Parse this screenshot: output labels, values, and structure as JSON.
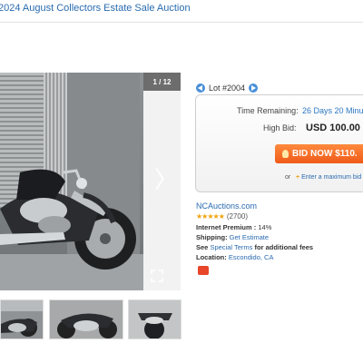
{
  "header": {
    "breadcrumb": "2024 August Collectors Estate Sale Auction"
  },
  "gallery": {
    "counter": "1 / 12",
    "thumbnails": [
      "thumb-1",
      "thumb-2",
      "thumb-3"
    ]
  },
  "lot": {
    "label": "Lot #2004"
  },
  "bid": {
    "time_label": "Time Remaining:",
    "time_value": "26 Days 20 Minu",
    "high_label": "High Bid:",
    "high_value": "USD 100.00",
    "button_label": "BID NOW $110.",
    "or_text": "or",
    "max_link": "Enter a maximum bid"
  },
  "seller": {
    "name": "NCAuctions.com",
    "stars": "★★★★★",
    "rating_count": "(2700)"
  },
  "info": {
    "premium_label": "Internet Premium :",
    "premium_value": "14%",
    "shipping_label": "Shipping:",
    "shipping_value": "Get Estimate",
    "terms_prefix": "See",
    "terms_link": "Special Terms",
    "terms_suffix": "for additional fees",
    "location_label": "Location:",
    "location_value": "Escondido, CA"
  },
  "colors": {
    "accent_blue": "#2a6bb0",
    "bid_orange": "#ef5a1a",
    "star_gold": "#f0a30a"
  },
  "icons": [
    "chevron-right-icon",
    "expand-icon",
    "prev-arrow-icon",
    "next-arrow-icon",
    "bulb-icon",
    "plus-icon",
    "rss-icon"
  ]
}
